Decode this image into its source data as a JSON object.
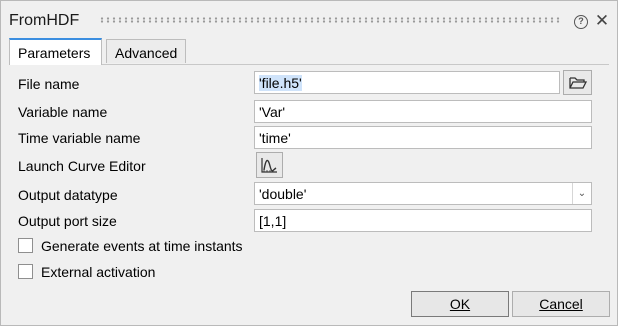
{
  "window": {
    "title": "FromHDF"
  },
  "tabs": [
    {
      "label": "Parameters"
    },
    {
      "label": "Advanced"
    }
  ],
  "fields": {
    "file_name": {
      "label": "File name",
      "value": "'file.h5'"
    },
    "variable_name": {
      "label": "Variable name",
      "value": "'Var'"
    },
    "time_variable_name": {
      "label": "Time variable name",
      "value": "'time'"
    },
    "launch_curve_editor": {
      "label": "Launch Curve Editor"
    },
    "output_datatype": {
      "label": "Output datatype",
      "value": "'double'"
    },
    "output_port_size": {
      "label": "Output port size",
      "value": "[1,1]"
    }
  },
  "checkboxes": {
    "generate_events": {
      "label": "Generate events at time instants",
      "checked": false
    },
    "external_activation": {
      "label": "External activation",
      "checked": false
    }
  },
  "buttons": {
    "ok_label": "OK",
    "cancel_label": "Cancel"
  },
  "icons": {
    "help": "help-icon",
    "close": "close-icon",
    "browse": "folder-open-icon",
    "curve": "curve-editor-icon",
    "dropdown": "chevron-down-icon"
  },
  "colors": {
    "tab_accent": "#3b8ee0",
    "selection": "#cfe3fa"
  }
}
